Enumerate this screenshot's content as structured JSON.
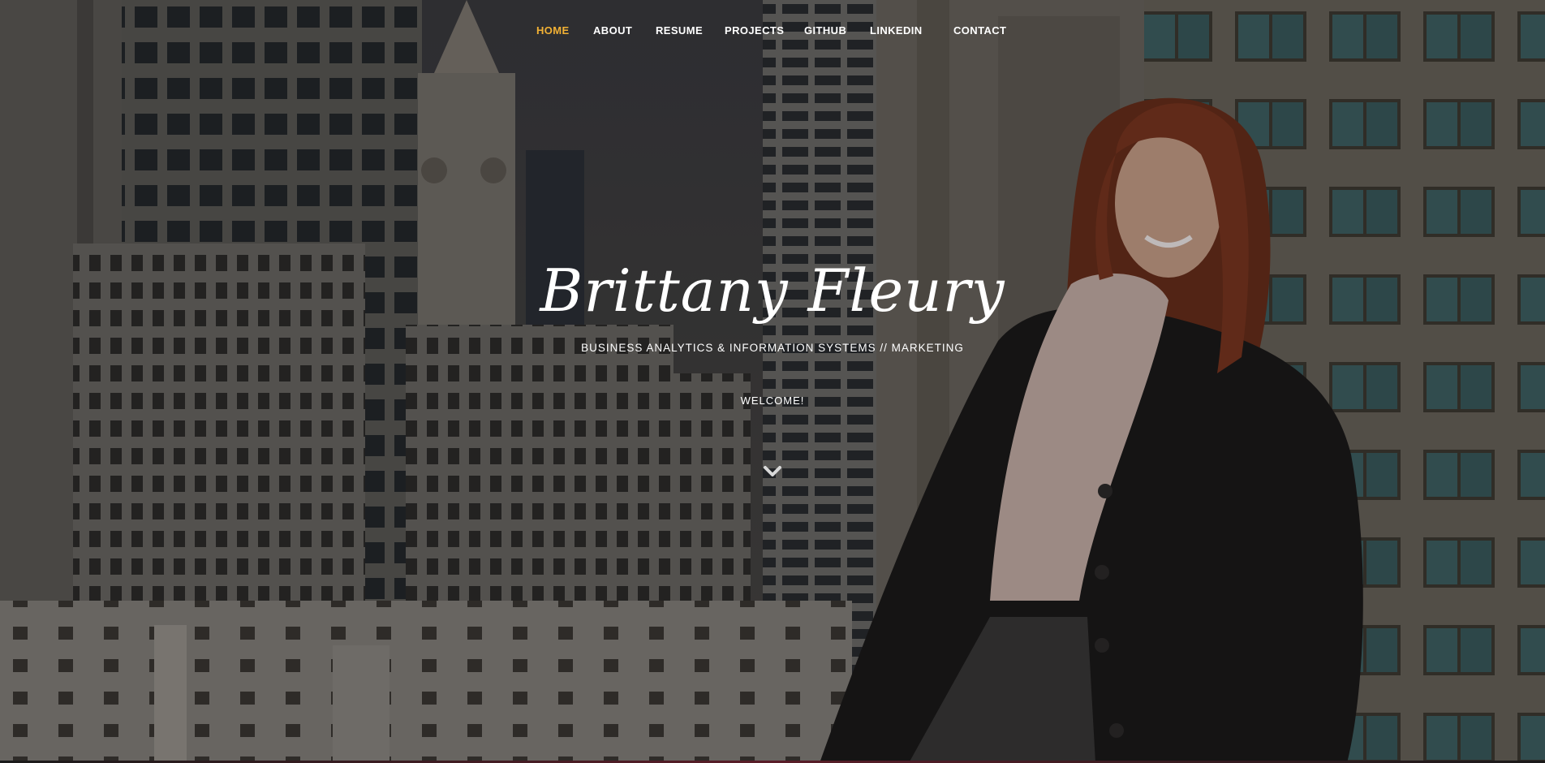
{
  "nav": {
    "items": [
      {
        "label": "HOME",
        "active": true
      },
      {
        "label": "ABOUT",
        "active": false
      },
      {
        "label": "RESUME",
        "active": false
      },
      {
        "label": "PROJECTS",
        "active": false
      },
      {
        "label": "GITHUB",
        "active": false
      },
      {
        "label": "LINKEDIN",
        "active": false
      },
      {
        "label": "CONTACT",
        "active": false
      }
    ],
    "active_color": "#f2b134",
    "text_color": "#ffffff"
  },
  "hero": {
    "title": "Brittany Fleury",
    "subtitle": "BUSINESS ANALYTICS & INFORMATION SYSTEMS // MARKETING",
    "welcome": "WELCOME!",
    "scroll_icon": "chevron-down-icon"
  }
}
